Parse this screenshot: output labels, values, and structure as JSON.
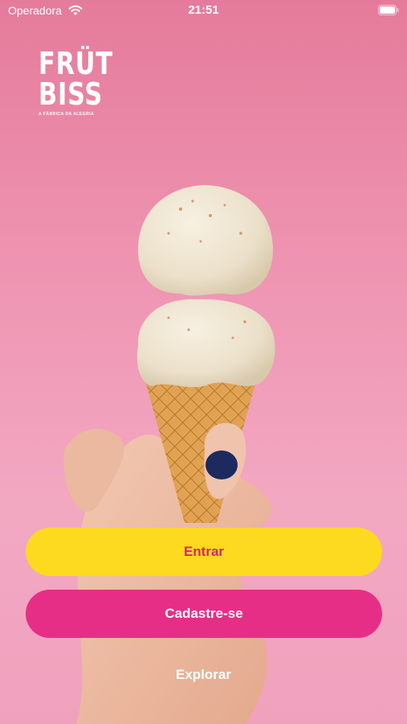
{
  "status_bar": {
    "carrier": "Operadora",
    "time": "21:51"
  },
  "logo": {
    "line1": "FRÜT",
    "line2": "BISS",
    "tagline": "A FÁBRICA DA ALEGRIA"
  },
  "actions": {
    "login_label": "Entrar",
    "signup_label": "Cadastre-se",
    "explore_label": "Explorar"
  },
  "colors": {
    "background": "#ee93b1",
    "primary_button": "#fdd91f",
    "primary_button_text": "#d12a6a",
    "secondary_button": "#e72e87",
    "secondary_button_text": "#ffffff"
  },
  "icons": {
    "wifi": "wifi-icon",
    "battery": "battery-icon"
  }
}
